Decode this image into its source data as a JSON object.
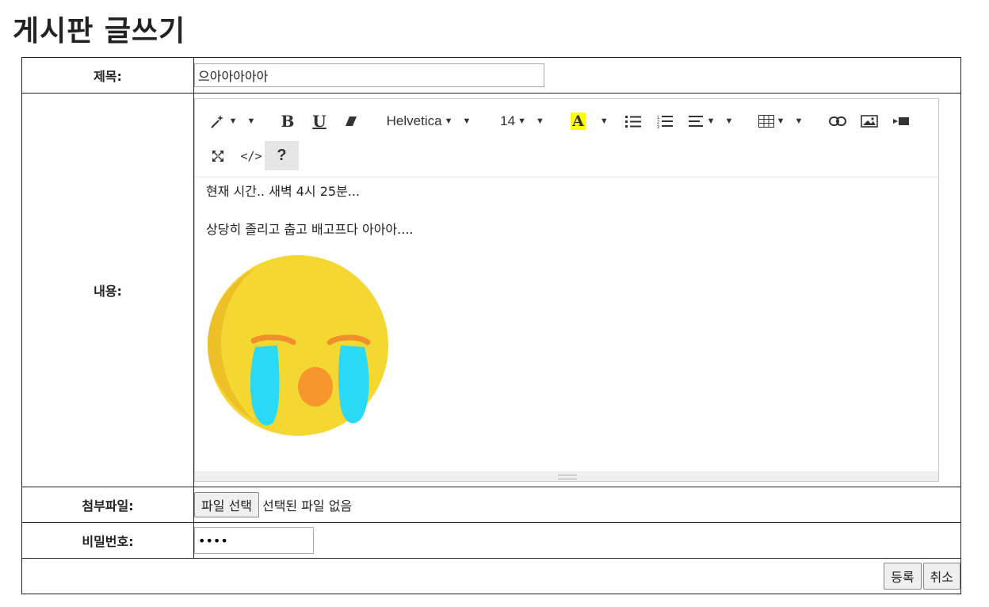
{
  "page_title": "게시판 글쓰기",
  "labels": {
    "title": "제목:",
    "content": "내용:",
    "attachment": "첨부파일:",
    "password": "비밀번호:"
  },
  "title_value": "으아아아아아",
  "editor": {
    "toolbar": {
      "font_name": "Helvetica",
      "font_size": "14",
      "highlight_letter": "A",
      "highlight_color": "#ffff00",
      "bold": "B",
      "underline": "U",
      "help": "?",
      "codeview": "</>"
    },
    "content_lines": [
      "현재 시간.. 새벽 4시 25분...",
      "상당히 졸리고 춥고 배고프다 아아아...."
    ],
    "image": {
      "type": "crying-emoji",
      "face_color": "#f5d732",
      "tear_color": "#29d9f5",
      "mouth_color": "#f7962d"
    }
  },
  "attachment": {
    "button_label": "파일 선택",
    "status": "선택된 파일 없음"
  },
  "password_value": "••••",
  "actions": {
    "submit": "등록",
    "cancel": "취소"
  }
}
